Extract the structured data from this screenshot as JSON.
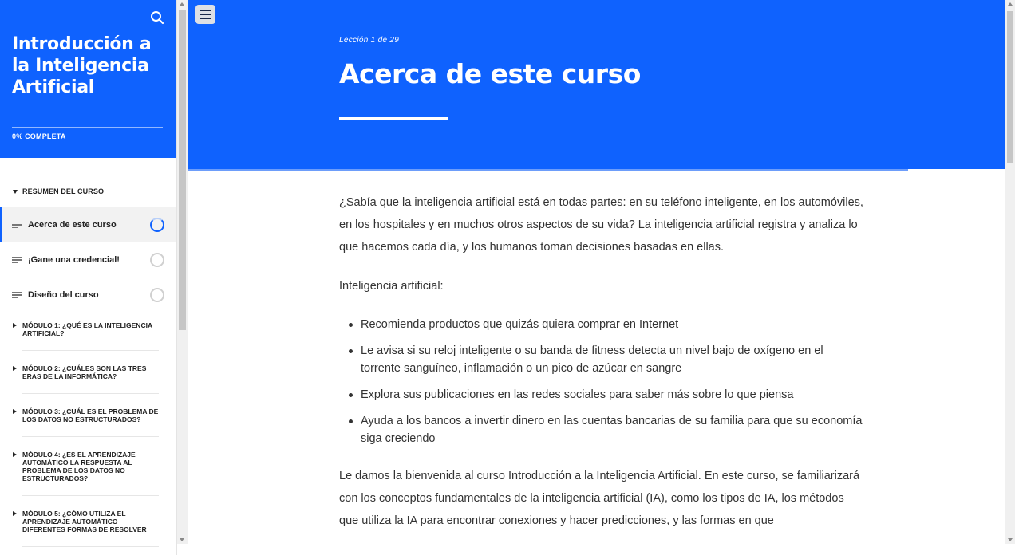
{
  "sidebar": {
    "course_title": "Introducción a la Inteligencia Artificial",
    "progress_label": "0% COMPLETA",
    "progress_fraction": 0,
    "section_label": "RESUMEN DEL CURSO",
    "lessons": [
      {
        "label": "Acerca de este curso",
        "status": "in-progress"
      },
      {
        "label": "¡Gane una credencial!",
        "status": "not-started"
      },
      {
        "label": "Diseño del curso",
        "status": "not-started"
      }
    ],
    "modules": [
      "MÓDULO 1: ¿QUÉ ES LA INTELIGENCIA ARTIFICIAL?",
      "MÓDULO 2: ¿CUÁLES SON LAS TRES ERAS DE LA INFORMÁTICA?",
      "MÓDULO 3: ¿CUÁL ES EL PROBLEMA DE LOS DATOS NO ESTRUCTURADOS?",
      "MÓDULO 4: ¿ES EL APRENDIZAJE AUTOMÁTICO LA RESPUESTA AL PROBLEMA DE LOS DATOS NO ESTRUCTURADOS?",
      "MÓDULO 5: ¿CÓMO UTILIZA EL APRENDIZAJE AUTOMÁTICO DIFERENTES FORMAS DE RESOLVER"
    ]
  },
  "header": {
    "lesson_counter": "Lección 1 de 29",
    "lesson_title": "Acerca de este curso"
  },
  "content": {
    "p1": "¿Sabía que la inteligencia artificial está en todas partes: en su teléfono inteligente, en los automóviles, en los hospitales y en muchos otros aspectos de su vida? La inteligencia artificial registra y analiza lo que hacemos cada día, y los humanos toman decisiones basadas en ellas.",
    "p2": "Inteligencia artificial:",
    "bullets": [
      "Recomienda productos que quizás quiera comprar en Internet",
      "Le avisa si su reloj inteligente o su banda de fitness detecta un nivel bajo de oxígeno en el torrente sanguíneo, inflamación o un pico de azúcar en sangre",
      "Explora sus publicaciones en las redes sociales para saber más sobre lo que piensa",
      "Ayuda a los bancos a invertir dinero en las cuentas bancarias de su familia para que su economía siga creciendo"
    ],
    "p3": "Le damos la bienvenida al curso Introducción a la Inteligencia Artificial. En este curso, se familiarizará con los conceptos fundamentales de la inteligencia artificial (IA), como los tipos de IA, los métodos que utiliza la IA para encontrar conexiones y hacer predicciones, y las formas en que"
  },
  "colors": {
    "brand_blue": "#0f62fe",
    "text": "#333333"
  },
  "icons": {
    "search": "search-icon",
    "menu": "hamburger-menu-icon",
    "lesson": "lesson-lines-icon",
    "status": "progress-circle-icon"
  }
}
